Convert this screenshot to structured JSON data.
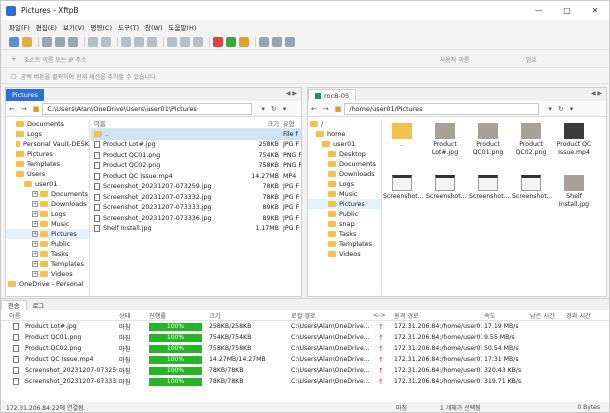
{
  "window": {
    "title": "Pictures - XftpB"
  },
  "menu": [
    "파일(F)",
    "편집(E)",
    "보기(V)",
    "명령(C)",
    "도구(T)",
    "창(W)",
    "도움말(H)"
  ],
  "connect": {
    "host_placeholder": "호스트 이름 또는 IP 주소",
    "user_placeholder": "사용자 이름",
    "password_placeholder": "암호"
  },
  "hint": "공백 버튼을 클릭하여 현재 세션을 추가할 수 있습니다.",
  "local": {
    "tab": "Pictures",
    "path": "C:\\Users\\Alan\\OneDrive\\Users\\user01\\Pictures",
    "tree": [
      {
        "label": "Documents"
      },
      {
        "label": "Logs"
      },
      {
        "label": "Personal Vault-DESK"
      },
      {
        "label": "Pictures"
      },
      {
        "label": "Templates"
      },
      {
        "label": "Users"
      },
      {
        "label": "user01"
      },
      {
        "label": "Documents"
      },
      {
        "label": "Downloads"
      },
      {
        "label": "Logs"
      },
      {
        "label": "Music"
      },
      {
        "label": "Pictures"
      },
      {
        "label": "Public"
      },
      {
        "label": "Tasks"
      },
      {
        "label": "Templates"
      },
      {
        "label": "Videos"
      },
      {
        "label": "OneDrive - Personal"
      }
    ],
    "columns": {
      "name": "이름",
      "size": "크기",
      "type": "유형"
    },
    "files": [
      {
        "name": "..",
        "size": "",
        "type": "File f"
      },
      {
        "name": "Product Lot#.jpg",
        "size": "258KB",
        "type": "JPG F"
      },
      {
        "name": "Product QC01.png",
        "size": "754KB",
        "type": "PNG F"
      },
      {
        "name": "Product QC02.png",
        "size": "758KB",
        "type": "PNG F"
      },
      {
        "name": "Product QC Issue.mp4",
        "size": "14.27MB",
        "type": "MP4"
      },
      {
        "name": "Screenshot_20231207-073259.jpg",
        "size": "78KB",
        "type": "JPG F"
      },
      {
        "name": "Screenshot_20231207-073332.jpg",
        "size": "78KB",
        "type": "JPG F"
      },
      {
        "name": "Screenshot_20231207-073333.jpg",
        "size": "89KB",
        "type": "JPG F"
      },
      {
        "name": "Screenshot_20231207-073336.jpg",
        "size": "89KB",
        "type": "JPG F"
      },
      {
        "name": "Shelf Install.jpg",
        "size": "1.17MB",
        "type": "JPG F"
      }
    ]
  },
  "remote": {
    "tab": "rocB-05",
    "path": "/home/user01/Pictures",
    "tree": [
      {
        "label": "/"
      },
      {
        "label": "home"
      },
      {
        "label": "user01"
      },
      {
        "label": "Desktop"
      },
      {
        "label": "Documents"
      },
      {
        "label": "Downloads"
      },
      {
        "label": "Logs"
      },
      {
        "label": "Music"
      },
      {
        "label": "Pictures"
      },
      {
        "label": "Public"
      },
      {
        "label": "snap"
      },
      {
        "label": "Tasks"
      },
      {
        "label": "Templates"
      },
      {
        "label": "Videos"
      }
    ],
    "thumbs": [
      {
        "label": "..",
        "kind": "folder"
      },
      {
        "label": "Product Lot#.jpg",
        "kind": "photo"
      },
      {
        "label": "Product QC01.png",
        "kind": "photo"
      },
      {
        "label": "Product QC02.png",
        "kind": "photo"
      },
      {
        "label": "Product QC Issue.mp4",
        "kind": "video"
      },
      {
        "label": "Screenshot...",
        "kind": "screen"
      },
      {
        "label": "Screenshot...",
        "kind": "screen"
      },
      {
        "label": "Screenshot...",
        "kind": "screen"
      },
      {
        "label": "Screenshot...",
        "kind": "screen"
      },
      {
        "label": "Shelf Install.jpg",
        "kind": "photo"
      }
    ]
  },
  "transfer": {
    "tabs": [
      "전송",
      "로그"
    ],
    "columns": [
      "이름",
      "상태",
      "진행률",
      "크기",
      "로컬 경로",
      "<->",
      "원격 경로",
      "속도",
      "남은 시간",
      "경과 시간"
    ],
    "rows": [
      {
        "name": "Product Lot#.jpg",
        "status": "마침",
        "progress": 100,
        "progress_label": "100%",
        "size": "258KB/258KB",
        "local": "C:\\Users\\Alan\\OneDrive...",
        "remote": "172.31.206.84:/home/user01/...",
        "speed": "17.19 MB/s"
      },
      {
        "name": "Product QC01.png",
        "status": "마침",
        "progress": 100,
        "progress_label": "100%",
        "size": "754KB/754KB",
        "local": "C:\\Users\\Alan\\OneDrive...",
        "remote": "172.31.206.84:/home/user01/...",
        "speed": "9.55 MB/s"
      },
      {
        "name": "Product QC02.png",
        "status": "마침",
        "progress": 100,
        "progress_label": "100%",
        "size": "758KB/758KB",
        "local": "C:\\Users\\Alan\\OneDrive...",
        "remote": "172.31.206.84:/home/user01/...",
        "speed": "50.54 MB/s"
      },
      {
        "name": "Product QC Issue.mp4",
        "status": "마침",
        "progress": 100,
        "progress_label": "100%",
        "size": "14.27MB/14.27MB",
        "local": "C:\\Users\\Alan\\OneDrive...",
        "remote": "172.31.206.84:/home/user01/...",
        "speed": "17.31 MB/s"
      },
      {
        "name": "Screenshot_20231207-073259...",
        "status": "마침",
        "progress": 100,
        "progress_label": "100%",
        "size": "78KB/78KB",
        "local": "C:\\Users\\Alan\\OneDrive...",
        "remote": "172.31.206.84:/home/user01/...",
        "speed": "320.43 KB/s"
      },
      {
        "name": "Screenshot_20231207-073332...",
        "status": "마침",
        "progress": 100,
        "progress_label": "100%",
        "size": "78KB/78KB",
        "local": "C:\\Users\\Alan\\OneDrive...",
        "remote": "172.31.206.84:/home/user01/...",
        "speed": "319.71 KB/s"
      }
    ]
  },
  "status": {
    "left": "172.31.206.84:22에 연결됨.",
    "mid": "마침",
    "count": "1 개체가 선택됨",
    "bytes": "0 Bytes"
  },
  "colors": {
    "accent": "#2f6fd0",
    "remote_tab": "#2e8b57",
    "progress": "#28b428",
    "folder": "#f2c14e"
  }
}
